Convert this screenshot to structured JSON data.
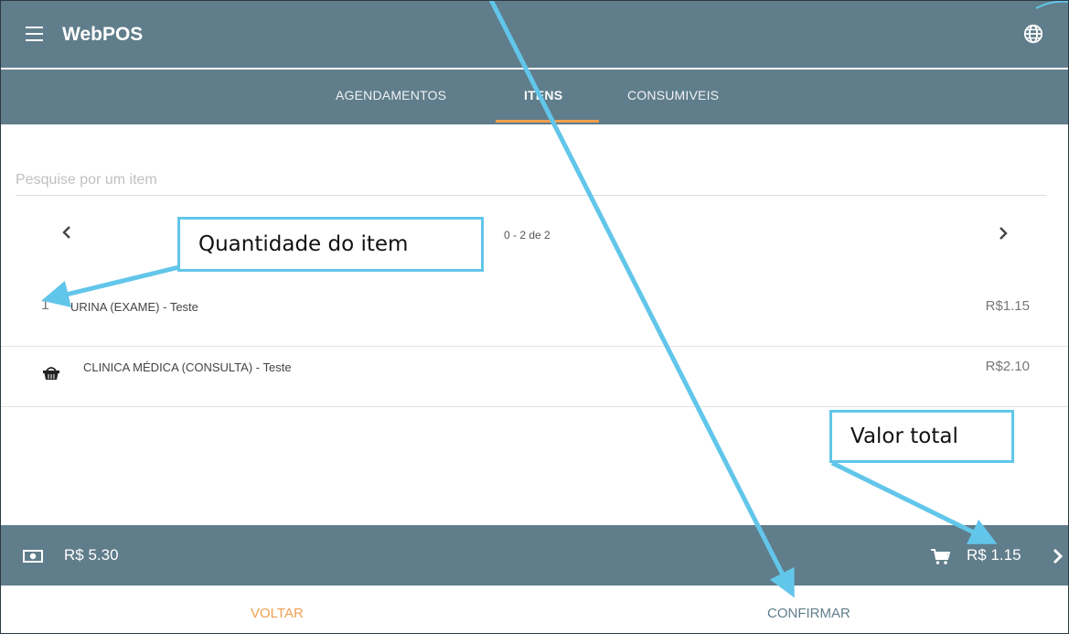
{
  "app": {
    "title": "WebPOS",
    "menu_icon": "hamburger-menu-icon",
    "language_icon": "globe-icon"
  },
  "tabs": [
    {
      "label": "AGENDAMENTOS",
      "active": false
    },
    {
      "label": "ITENS",
      "active": true
    },
    {
      "label": "CONSUMIVEIS",
      "active": false
    }
  ],
  "search": {
    "placeholder": "Pesquise por um item",
    "value": ""
  },
  "pagination": {
    "text": "0 - 2 de 2"
  },
  "items": [
    {
      "quantity": "1",
      "icon": null,
      "name": "URINA (EXAME) - Teste",
      "price": "R$1.15"
    },
    {
      "quantity": null,
      "icon": "basket-icon",
      "name": "CLINICA MÉDICA (CONSULTA) - Teste",
      "price": "R$2.10"
    }
  ],
  "summary": {
    "balance": "R$ 5.30",
    "cart_total": "R$ 1.15"
  },
  "footer": {
    "back_label": "VOLTAR",
    "confirm_label": "CONFIRMAR"
  },
  "annotations": {
    "quantity_callout": "Quantidade do item",
    "total_callout": "Valor total"
  },
  "colors": {
    "primary": "#607d8b",
    "accent": "#f0a050",
    "annotation": "#62c6ea"
  }
}
